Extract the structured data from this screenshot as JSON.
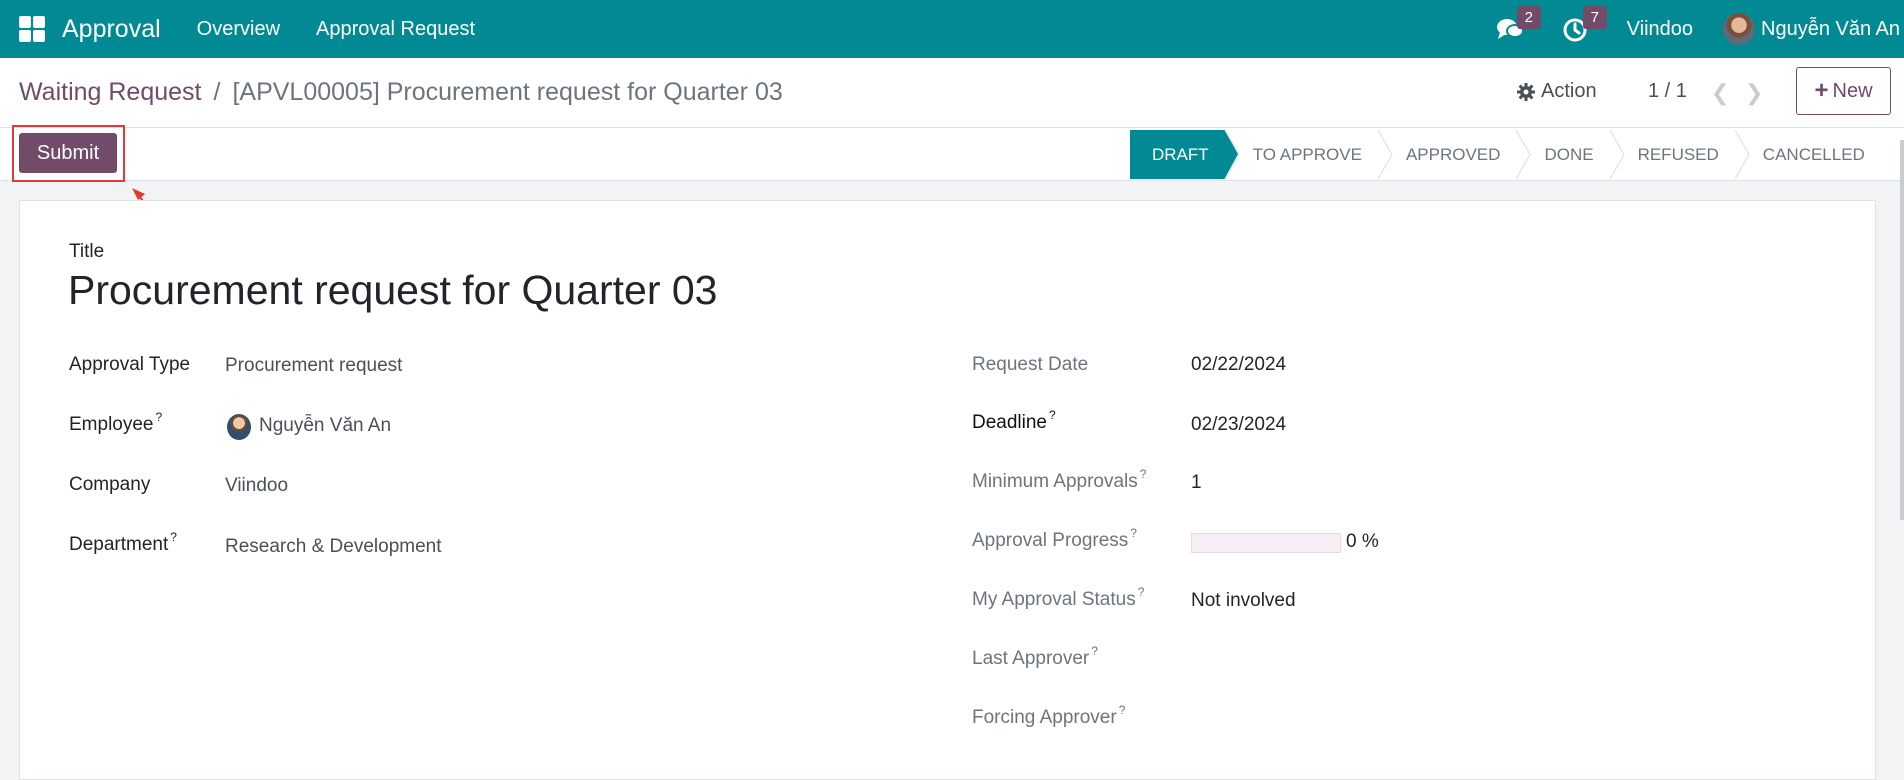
{
  "navbar": {
    "app_name": "Approval",
    "menu": [
      "Overview",
      "Approval Request"
    ],
    "messages_badge": "2",
    "activities_badge": "7",
    "company": "Viindoo",
    "user": "Nguyễn Văn An"
  },
  "breadcrumb": {
    "parent": "Waiting Request",
    "separator": "/",
    "current": "[APVL00005] Procurement request for Quarter 03"
  },
  "control": {
    "action_label": "Action",
    "pager": "1 / 1",
    "new_label": "New"
  },
  "statusbar": {
    "submit_label": "Submit",
    "stages": [
      "Draft",
      "To Approve",
      "Approved",
      "Done",
      "Refused",
      "Cancelled"
    ],
    "active_stage": "Draft"
  },
  "form": {
    "title_label": "Title",
    "title_value": "Procurement request for Quarter 03",
    "left": {
      "approval_type_label": "Approval Type",
      "approval_type_value": "Procurement request",
      "employee_label": "Employee",
      "employee_value": "Nguyễn Văn An",
      "company_label": "Company",
      "company_value": "Viindoo",
      "department_label": "Department",
      "department_value": "Research & Development"
    },
    "right": {
      "request_date_label": "Request Date",
      "request_date_value": "02/22/2024",
      "deadline_label": "Deadline",
      "deadline_value": "02/23/2024",
      "min_approvals_label": "Minimum Approvals",
      "min_approvals_value": "1",
      "progress_label": "Approval Progress",
      "progress_value": 0,
      "progress_text": "0 %",
      "my_status_label": "My Approval Status",
      "my_status_value": "Not involved",
      "last_approver_label": "Last Approver",
      "forcing_approver_label": "Forcing Approver"
    },
    "help_mark": "?"
  },
  "colors": {
    "navbar": "#018a94",
    "primary": "#714b67",
    "highlight": "#e53935"
  }
}
